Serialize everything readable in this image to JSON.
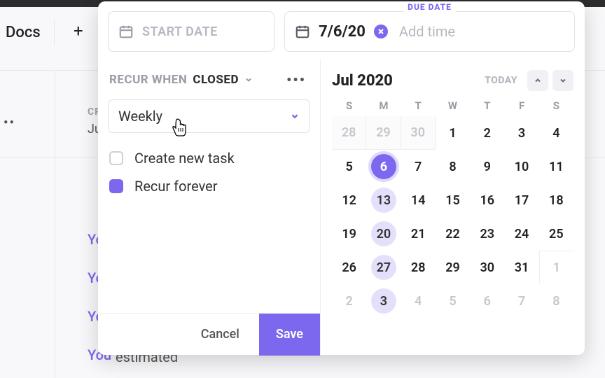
{
  "background": {
    "docs": "Docs",
    "plus": "+",
    "cr": "CR",
    "ju": "Ju",
    "you_lines": [
      "Yo",
      "Yo",
      "Yo",
      "You"
    ],
    "estimated": "estimated"
  },
  "popover": {
    "start": {
      "placeholder": "START DATE"
    },
    "due": {
      "label": "DUE DATE",
      "value": "7/6/20",
      "add_time": "Add time"
    },
    "recur": {
      "label": "RECUR WHEN",
      "state": "CLOSED"
    },
    "frequency": {
      "value": "Weekly"
    },
    "checks": {
      "create_new_task": {
        "label": "Create new task",
        "checked": false
      },
      "recur_forever": {
        "label": "Recur forever",
        "checked": true
      }
    },
    "buttons": {
      "cancel": "Cancel",
      "save": "Save"
    }
  },
  "calendar": {
    "month_label": "Jul 2020",
    "today_label": "TODAY",
    "dow": [
      "S",
      "M",
      "T",
      "W",
      "T",
      "F",
      "S"
    ],
    "weeks": [
      [
        {
          "d": 28,
          "other": true,
          "prevshade": true
        },
        {
          "d": 29,
          "other": true,
          "prevshade": true
        },
        {
          "d": 30,
          "other": true,
          "prevshade": true
        },
        {
          "d": 1
        },
        {
          "d": 2
        },
        {
          "d": 3
        },
        {
          "d": 4
        }
      ],
      [
        {
          "d": 5
        },
        {
          "d": 6,
          "sel": true
        },
        {
          "d": 7
        },
        {
          "d": 8
        },
        {
          "d": 9
        },
        {
          "d": 10
        },
        {
          "d": 11
        }
      ],
      [
        {
          "d": 12
        },
        {
          "d": 13,
          "hl": true
        },
        {
          "d": 14
        },
        {
          "d": 15
        },
        {
          "d": 16
        },
        {
          "d": 17
        },
        {
          "d": 18
        }
      ],
      [
        {
          "d": 19
        },
        {
          "d": 20,
          "hl": true
        },
        {
          "d": 21
        },
        {
          "d": 22
        },
        {
          "d": 23
        },
        {
          "d": 24
        },
        {
          "d": 25
        }
      ],
      [
        {
          "d": 26
        },
        {
          "d": 27,
          "hl": true
        },
        {
          "d": 28
        },
        {
          "d": 29
        },
        {
          "d": 30
        },
        {
          "d": 31
        },
        {
          "d": 1,
          "other": true,
          "nextshade": true
        }
      ],
      [
        {
          "d": 2,
          "other": true
        },
        {
          "d": 3,
          "other": true,
          "hl": true
        },
        {
          "d": 4,
          "other": true
        },
        {
          "d": 5,
          "other": true
        },
        {
          "d": 6,
          "other": true
        },
        {
          "d": 7,
          "other": true
        },
        {
          "d": 8,
          "other": true
        }
      ]
    ]
  },
  "colors": {
    "accent": "#7b68ee"
  }
}
